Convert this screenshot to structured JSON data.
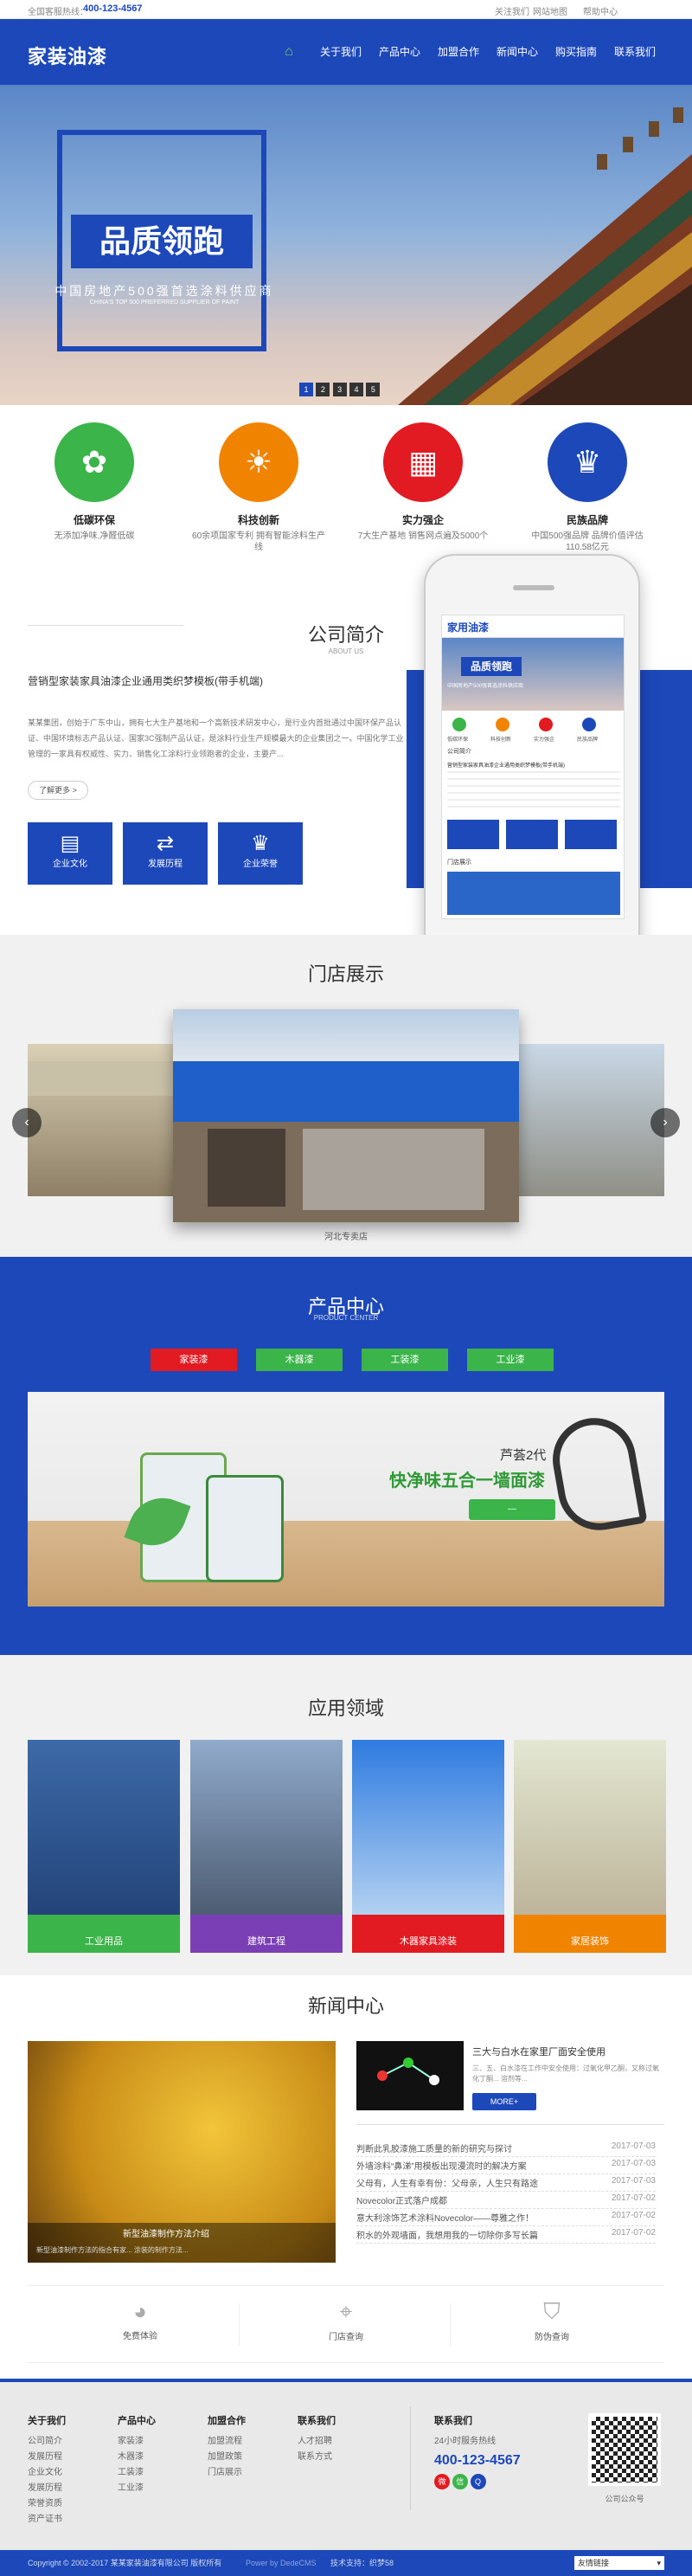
{
  "topbar": {
    "welcome": "全国客服热线：",
    "phone": "400-123-4567",
    "links": [
      "关注我们",
      "网站地图",
      "帮助中心"
    ]
  },
  "header": {
    "logo": "家装油漆",
    "nav": [
      "⌂",
      "关于我们",
      "产品中心",
      "加盟合作",
      "新闻中心",
      "购买指南",
      "联系我们"
    ]
  },
  "hero": {
    "headline": "品质领跑",
    "sub": "中国房地产500强首选涂料供应商",
    "sub_en": "CHINA'S TOP 500 PREFERRED SUPPLIER OF PAINT",
    "dots": [
      "1",
      "2",
      "3",
      "4",
      "5"
    ]
  },
  "features": [
    {
      "title": "低碳环保",
      "desc": "无添加净味,净醛低碳",
      "color": "#3bb54a",
      "icon": "✿"
    },
    {
      "title": "科技创新",
      "desc": "60余项国家专利 拥有智能涂料生产线",
      "color": "#f08300",
      "icon": "☀"
    },
    {
      "title": "实力强企",
      "desc": "7大生产基地 销售网点遍及5000个",
      "color": "#e21a22",
      "icon": "▦"
    },
    {
      "title": "民族品牌",
      "desc": "中国500强品牌 品牌价值评估110.58亿元",
      "color": "#1d48b9",
      "icon": "♛"
    }
  ],
  "about": {
    "title": "公司简介",
    "title_en": "ABOUT US",
    "subtitle": "营销型家装家具油漆企业通用类织梦模板(带手机端)",
    "body": "某某集团，创始于广东中山，拥有七大生产基地和一个高新技术研发中心，是行业内首批通过中国环保产品认证、中国环境标志产品认证、国家3C强制产品认证，是涂料行业生产规模最大的企业集团之一。中国化学工业管理的一家具有权威性、实力、销售化工涂料行业领跑者的企业，主要产...",
    "more": "了解更多 >",
    "buttons": [
      {
        "label": "企业文化",
        "icon": "▤"
      },
      {
        "label": "发展历程",
        "icon": "⇄"
      },
      {
        "label": "企业荣誉",
        "icon": "♛"
      }
    ]
  },
  "phone": {
    "logo": "家用油漆",
    "headline": "品质领跑",
    "sub": "中国房地产500强首选涂料供应商",
    "icons": [
      "低碳环保",
      "科技创新",
      "实力强企",
      "民族品牌"
    ],
    "section1": "公司简介",
    "line": "营销型家装家具油漆企业通用类织梦模板(带手机端)",
    "section2": "门店展示"
  },
  "stores": {
    "title": "门店展示",
    "caption": "河北专卖店"
  },
  "products": {
    "title": "产品中心",
    "title_en": "PRODUCT CENTER",
    "tabs": [
      {
        "label": "家装漆",
        "color": "#e21a22"
      },
      {
        "label": "木器漆",
        "color": "#3bb54a"
      },
      {
        "label": "工装漆",
        "color": "#3bb54a"
      },
      {
        "label": "工业漆",
        "color": "#3bb54a"
      }
    ],
    "banner_brand": "芦荟2代",
    "banner_title": "快净味五合一墙面漆",
    "banner_btn": "—"
  },
  "application": {
    "title": "应用领域",
    "items": [
      "工业用品",
      "建筑工程",
      "木器家具涂装",
      "家居装饰"
    ]
  },
  "news": {
    "title": "新闻中心",
    "featured_caption": "新型油漆制作方法介绍",
    "featured_desc": "新型油漆制作方法的指合有家... 涂装的制作方法...",
    "top_title": "三大与白水在家里厂面安全使用",
    "top_desc": "三、五、白水漆在工作中安全使用：过氧化甲乙酮，又称过氧化丁酮... 溶剂等...",
    "top_more": "MORE+",
    "list": [
      {
        "t": "判断此乳胶漆施工质量的新的研究与探讨",
        "d": "2017-07-03"
      },
      {
        "t": "外墙涂料“鼻涕”用模板出现漫流时的解决方案",
        "d": "2017-07-03"
      },
      {
        "t": "父母有，人生有幸有份：父母亲，人生只有路途",
        "d": "2017-07-03"
      },
      {
        "t": "Novecolor正式落户成都",
        "d": "2017-07-02"
      },
      {
        "t": "意大利涂饰艺术涂料Novecolor——尊雅之作！",
        "d": "2017-07-02"
      },
      {
        "t": "积水的外观墙面，我想用我的一切除你多写长篇",
        "d": "2017-07-02"
      }
    ]
  },
  "services": [
    "免费体验",
    "门店查询",
    "防伪查询"
  ],
  "footer": {
    "cols": [
      {
        "title": "关于我们",
        "items": [
          "公司简介",
          "发展历程",
          "企业文化",
          "发展历程",
          "荣誉资质",
          "资产证书"
        ]
      },
      {
        "title": "产品中心",
        "items": [
          "家装漆",
          "木器漆",
          "工装漆",
          "工业漆"
        ]
      },
      {
        "title": "加盟合作",
        "items": [
          "加盟流程",
          "加盟政策",
          "门店展示"
        ]
      },
      {
        "title": "联系我们",
        "items": [
          "人才招聘",
          "联系方式"
        ]
      }
    ],
    "contact_title": "联系我们",
    "contact_hours": "24小时服务热线",
    "contact_phone": "400-123-4567",
    "qr_label": "公司公众号"
  },
  "bottom": {
    "copyright": "Copyright © 2002-2017 某某家装油漆有限公司 版权所有",
    "powered": "Power by DedeCMS",
    "tech": "技术支持：织梦58",
    "select": "友情链接"
  }
}
